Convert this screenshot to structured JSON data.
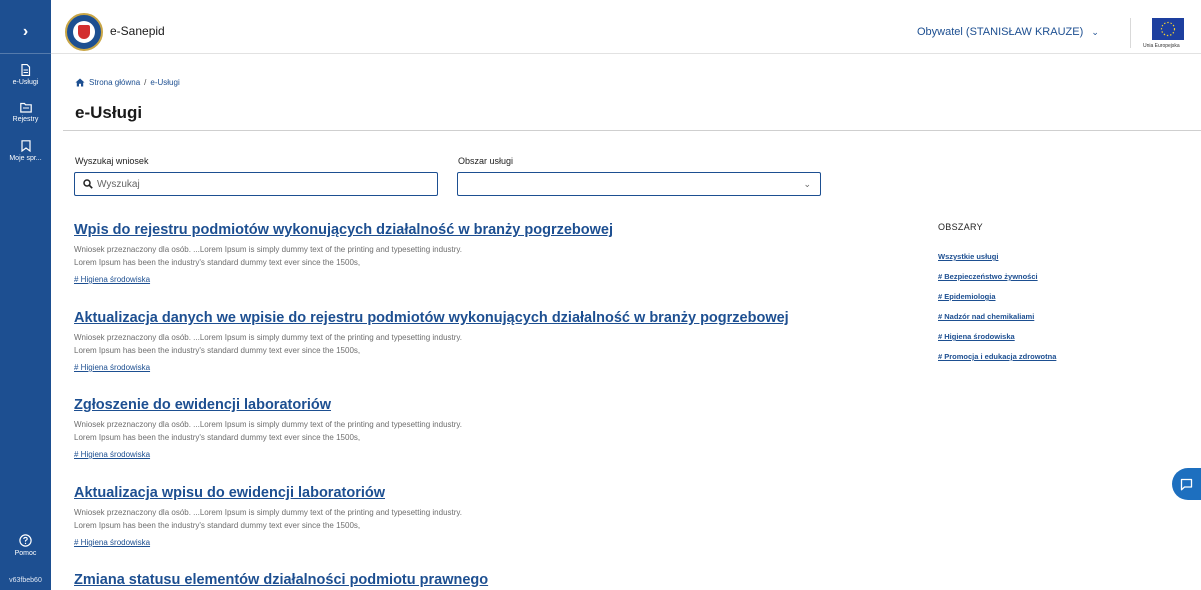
{
  "app": {
    "title": "e-Sanepid"
  },
  "sidebar": {
    "items": [
      {
        "label": "e-Usługi",
        "icon": "document-icon"
      },
      {
        "label": "Rejestry",
        "icon": "folder-icon"
      },
      {
        "label": "Moje spr...",
        "icon": "bookmark-icon"
      }
    ],
    "help_label": "Pomoc",
    "version": "v63fbeb60"
  },
  "header": {
    "user_label": "Obywatel (STANISŁAW KRAUZE)",
    "eu_label": "Unia Europejska"
  },
  "breadcrumb": {
    "home": "Strona główna",
    "separator": "/",
    "current": "e-Usługi"
  },
  "page": {
    "title": "e-Usługi"
  },
  "filters": {
    "search_label": "Wyszukaj wniosek",
    "search_placeholder": "Wyszukaj",
    "search_value": "",
    "area_label": "Obszar usługi",
    "area_value": ""
  },
  "services": [
    {
      "title": "Wpis do rejestru podmiotów wykonujących działalność w branży pogrzebowej",
      "desc_line1": "Wniosek przeznaczony dla osób. ...Lorem Ipsum is simply dummy text of the printing and typesetting industry.",
      "desc_line2": "Lorem Ipsum has been the industry's standard dummy text ever since the 1500s,",
      "tag": "# Higiena środowiska"
    },
    {
      "title": "Aktualizacja danych we wpisie do rejestru podmiotów wykonujących działalność w branży pogrzebowej",
      "desc_line1": "Wniosek przeznaczony dla osób. ...Lorem Ipsum is simply dummy text of the printing and typesetting industry.",
      "desc_line2": "Lorem Ipsum has been the industry's standard dummy text ever since the 1500s,",
      "tag": "# Higiena środowiska"
    },
    {
      "title": "Zgłoszenie do ewidencji laboratoriów",
      "desc_line1": "Wniosek przeznaczony dla osób. ...Lorem Ipsum is simply dummy text of the printing and typesetting industry.",
      "desc_line2": "Lorem Ipsum has been the industry's standard dummy text ever since the 1500s,",
      "tag": "# Higiena środowiska"
    },
    {
      "title": "Aktualizacja wpisu do ewidencji laboratoriów",
      "desc_line1": "Wniosek przeznaczony dla osób. ...Lorem Ipsum is simply dummy text of the printing and typesetting industry.",
      "desc_line2": "Lorem Ipsum has been the industry's standard dummy text ever since the 1500s,",
      "tag": "# Higiena środowiska"
    },
    {
      "title": "Zmiana statusu elementów działalności podmiotu prawnego"
    }
  ],
  "areas": {
    "title": "OBSZARY",
    "links": [
      "Wszystkie usługi",
      "# Bezpieczeństwo żywności",
      "# Epidemiologia",
      "# Nadzór nad chemikaliami",
      "# Higiena środowiska",
      "# Promocja i edukacja zdrowotna"
    ]
  },
  "colors": {
    "primary": "#1d4f91",
    "sidebar": "#1d4f91",
    "muted_text": "#6e6e6e",
    "fab": "#1d6fbf"
  }
}
